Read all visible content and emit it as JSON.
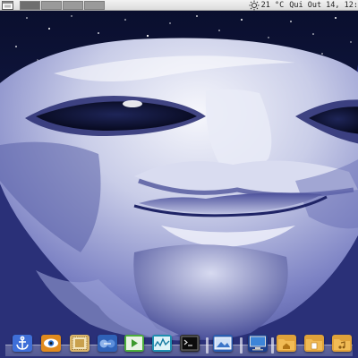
{
  "top_panel": {
    "menu_icon": "window-menu-icon",
    "workspace_count": 4,
    "weather_icon": "sun-icon",
    "temperature": "21 °C",
    "clock": "Qui Out 14, 12:"
  },
  "dock": {
    "items": [
      {
        "name": "anchor-app-icon",
        "label": ""
      },
      {
        "name": "eye-app-icon",
        "label": ""
      },
      {
        "name": "stamp-app-icon",
        "label": ""
      },
      {
        "name": "network-app-icon",
        "label": ""
      },
      {
        "name": "media-player-icon",
        "label": ""
      },
      {
        "name": "system-monitor-icon",
        "label": ""
      },
      {
        "name": "terminal-icon",
        "label": ""
      },
      {
        "name": "screenshot-app-icon",
        "label": ""
      },
      {
        "name": "display-icon",
        "label": ""
      },
      {
        "name": "home-folder-icon",
        "label": ""
      },
      {
        "name": "documents-folder-icon",
        "label": ""
      },
      {
        "name": "music-folder-icon",
        "label": ""
      }
    ]
  },
  "wallpaper": {
    "subject": "face-wallpaper"
  },
  "colors": {
    "panel": "#e6e6e6",
    "night_sky": "#0d1236",
    "face_light": "#f4f5fb",
    "face_shadow": "#3a3f8a"
  }
}
